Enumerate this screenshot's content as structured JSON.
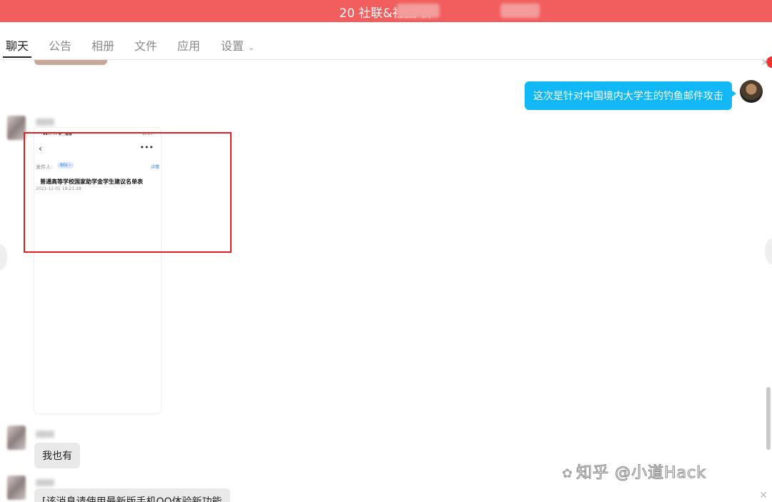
{
  "window": {
    "title": "20 社联&社团 群"
  },
  "tabs": [
    {
      "label": "聊天"
    },
    {
      "label": "公告"
    },
    {
      "label": "相册"
    },
    {
      "label": "文件"
    },
    {
      "label": "应用"
    },
    {
      "label": "设置"
    }
  ],
  "messages": {
    "mine": {
      "text": "这次是针对中国境内大学生的钓鱼邮件攻击"
    },
    "screenshot": {
      "status_right": "12:03",
      "sender_label": "发件人:",
      "sender_chip": "80s ›",
      "detail_link": "详情",
      "mail_title": "普通高等学校国家助学金学生建议名单表",
      "mail_date": "2021-12-01 19:21:28"
    },
    "reply1": {
      "text": "我也有"
    },
    "reply2": {
      "text": "[该消息请使用最新版手机QQ体验新功能"
    }
  },
  "watermark": {
    "text": "知乎 @小道Hack"
  },
  "colors": {
    "title_bar": "#f25d5d",
    "my_bubble": "#12b7f5",
    "highlight_box": "#e02020"
  }
}
